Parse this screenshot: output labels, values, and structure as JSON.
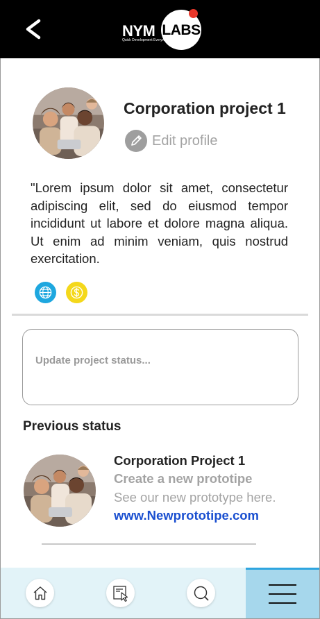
{
  "header": {
    "logo_text_left": "NYM",
    "logo_text_right": "LABS",
    "logo_tagline": "Quick Development Everywhere",
    "back_icon": "chevron-left-icon"
  },
  "profile": {
    "title": "Corporation project 1",
    "edit_label": "Edit profile",
    "description": "\"Lorem ipsum dolor sit amet, consectetur adipiscing elit, sed do eiusmod tempor incididunt ut labore et dolore magna aliqua. Ut enim ad minim veniam, quis nostrud exercitation.",
    "icons": [
      "globe-icon",
      "dollar-coin-icon"
    ]
  },
  "status_input": {
    "placeholder": "Update project status..."
  },
  "previous": {
    "heading": "Previous status",
    "items": [
      {
        "title": "Corporation Project 1",
        "subtitle": "Create a new prototipe",
        "text": "See our new prototype here.",
        "link": "www.Newprototipe.com"
      }
    ]
  },
  "bottom_nav": {
    "items": [
      "home-icon",
      "prototype-icon",
      "search-icon",
      "menu-icon"
    ],
    "active": "menu-icon"
  },
  "colors": {
    "header_bg": "#000000",
    "logo_dot": "#e8372a",
    "globe": "#1ea7df",
    "coin": "#f4d81b",
    "link": "#1a4fd0",
    "nav_bg": "#e2f3f8",
    "nav_active_bg": "#a6d7ec",
    "nav_active_border": "#2ea5df"
  }
}
